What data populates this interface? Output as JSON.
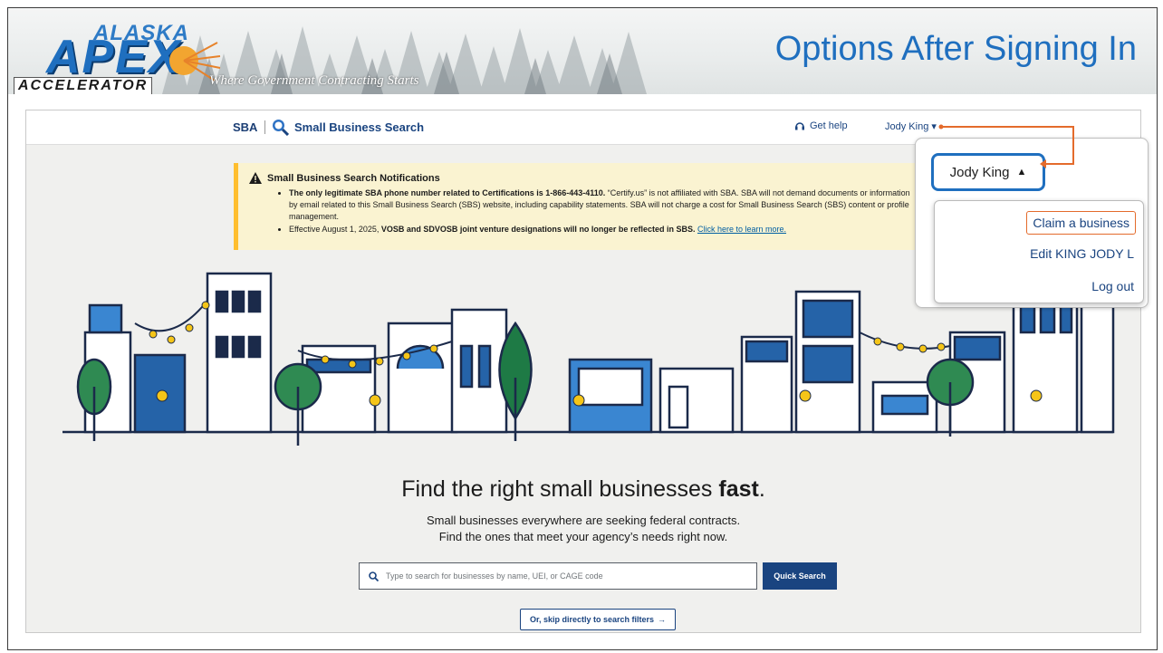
{
  "slide": {
    "title": "Options After Signing In",
    "logo": {
      "line1": "ALASKA",
      "line2": "APEX",
      "line3": "ACCELERATOR"
    },
    "tagline": "Where Government Contracting Starts"
  },
  "app": {
    "agency_logo": "SBA",
    "name": "Small Business Search",
    "get_help": "Get help",
    "user": "Jody King"
  },
  "notice": {
    "title": "Small Business Search Notifications",
    "item1_bold": "The only legitimate SBA phone number related to Certifications is 1-866-443-4110.",
    "item1_rest": " “Certify.us” is not affiliated with SBA. SBA will not demand documents or information by email related to this Small Business Search (SBS) website, including capability statements. SBA will not charge a cost for Small Business Search (SBS) content or profile management.",
    "item2_pre": "Effective August 1, 2025, ",
    "item2_bold": "VOSB and SDVOSB joint venture designations will no longer be reflected in SBS.",
    "item2_link": "Click here to learn more."
  },
  "hero": {
    "title_pre": "Find the right small businesses ",
    "title_bold": "fast",
    "title_post": ".",
    "sub1": "Small businesses everywhere are seeking federal contracts.",
    "sub2": "Find the ones that meet your agency’s needs right now."
  },
  "search": {
    "placeholder": "Type to search for businesses by name, UEI, or CAGE code",
    "button": "Quick Search",
    "skip": "Or, skip directly to search filters"
  },
  "menu": {
    "user": "Jody King",
    "items": [
      "Claim a business",
      "Edit KING JODY L",
      "Log out"
    ]
  },
  "colors": {
    "accent": "#1f6fbf",
    "navy": "#1a4480",
    "highlight": "#e46b2c",
    "notice_bg": "#faf3d1"
  }
}
